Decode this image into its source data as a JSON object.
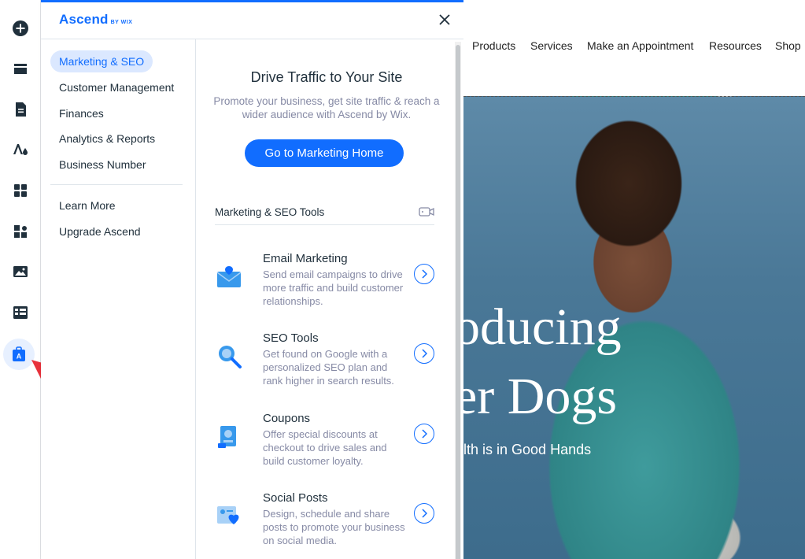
{
  "toolbar": {
    "items": [
      {
        "name": "add-elements",
        "icon": "plus-circle-icon"
      },
      {
        "name": "add-section",
        "icon": "section-icon"
      },
      {
        "name": "pages",
        "icon": "page-icon"
      },
      {
        "name": "site-design",
        "icon": "design-icon"
      },
      {
        "name": "app-market",
        "icon": "apps-icon"
      },
      {
        "name": "my-business",
        "icon": "puzzle-icon"
      },
      {
        "name": "media",
        "icon": "image-icon"
      },
      {
        "name": "cms",
        "icon": "table-icon"
      },
      {
        "name": "ascend",
        "icon": "ascend-bag-icon",
        "active": true
      }
    ]
  },
  "panel": {
    "logo": "Ascend",
    "logo_by": "BY WIX",
    "menu": {
      "items": [
        "Marketing & SEO",
        "Customer Management",
        "Finances",
        "Analytics & Reports",
        "Business Number"
      ],
      "extra": [
        "Learn More",
        "Upgrade Ascend"
      ],
      "active": "Marketing & SEO"
    },
    "content": {
      "title": "Drive Traffic to Your Site",
      "description": "Promote your business, get site traffic & reach a wider audience with Ascend by Wix.",
      "cta": "Go to Marketing Home",
      "tools_heading": "Marketing & SEO Tools",
      "tools": [
        {
          "title": "Email Marketing",
          "description": "Send email campaigns to drive more traffic and build customer relationships.",
          "icon": "email-icon"
        },
        {
          "title": "SEO Tools",
          "description": "Get found on Google with a personalized SEO plan and rank higher in search results.",
          "icon": "seo-search-icon"
        },
        {
          "title": "Coupons",
          "description": "Offer special discounts at checkout to drive sales and build customer loyalty.",
          "icon": "coupon-icon"
        },
        {
          "title": "Social Posts",
          "description": "Design, schedule and share posts to promote your business on social media.",
          "icon": "social-heart-icon"
        }
      ]
    }
  },
  "site": {
    "nav": [
      "Products",
      "Services",
      "Make an Appointment",
      "Resources",
      "Shop"
    ],
    "hero_line1": "oducing",
    "hero_line2": "er Dogs",
    "hero_line3": "alth is in Good Hands"
  },
  "colors": {
    "accent": "#116dff",
    "active_bg": "#dbe8ff",
    "muted_text": "#868aa5",
    "annotation_arrow": "#e8323c"
  }
}
